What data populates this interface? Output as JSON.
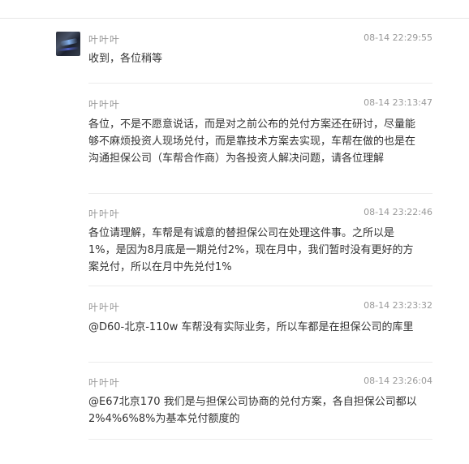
{
  "posts": [
    {
      "author": "叶叶叶",
      "time": "08-14 22:29:55",
      "text": "收到，各位稍等"
    },
    {
      "author": "叶叶叶",
      "time": "08-14 23:13:47",
      "text": "各位，不是不愿意说话，而是对之前公布的兑付方案还在研讨，尽量能够不麻烦投资人现场兑付，而是靠技术方案去实现，车帮在做的也是在沟通担保公司（车帮合作商）为各投资人解决问题，请各位理解"
    },
    {
      "author": "叶叶叶",
      "time": "08-14 23:22:46",
      "text": "各位请理解，车帮是有诚意的替担保公司在处理这件事。之所以是1%，是因为8月底是一期兑付2%，现在月中，我们暂时没有更好的方案兑付，所以在月中先兑付1%"
    },
    {
      "author": "叶叶叶",
      "time": "08-14 23:23:32",
      "text": "@D60-北京-110w 车帮没有实际业务，所以车都是在担保公司的库里"
    },
    {
      "author": "叶叶叶",
      "time": "08-14 23:26:04",
      "text": "@E67北京170 我们是与担保公司协商的兑付方案，各自担保公司都以2%4%6%8%为基本兑付额度的"
    }
  ]
}
